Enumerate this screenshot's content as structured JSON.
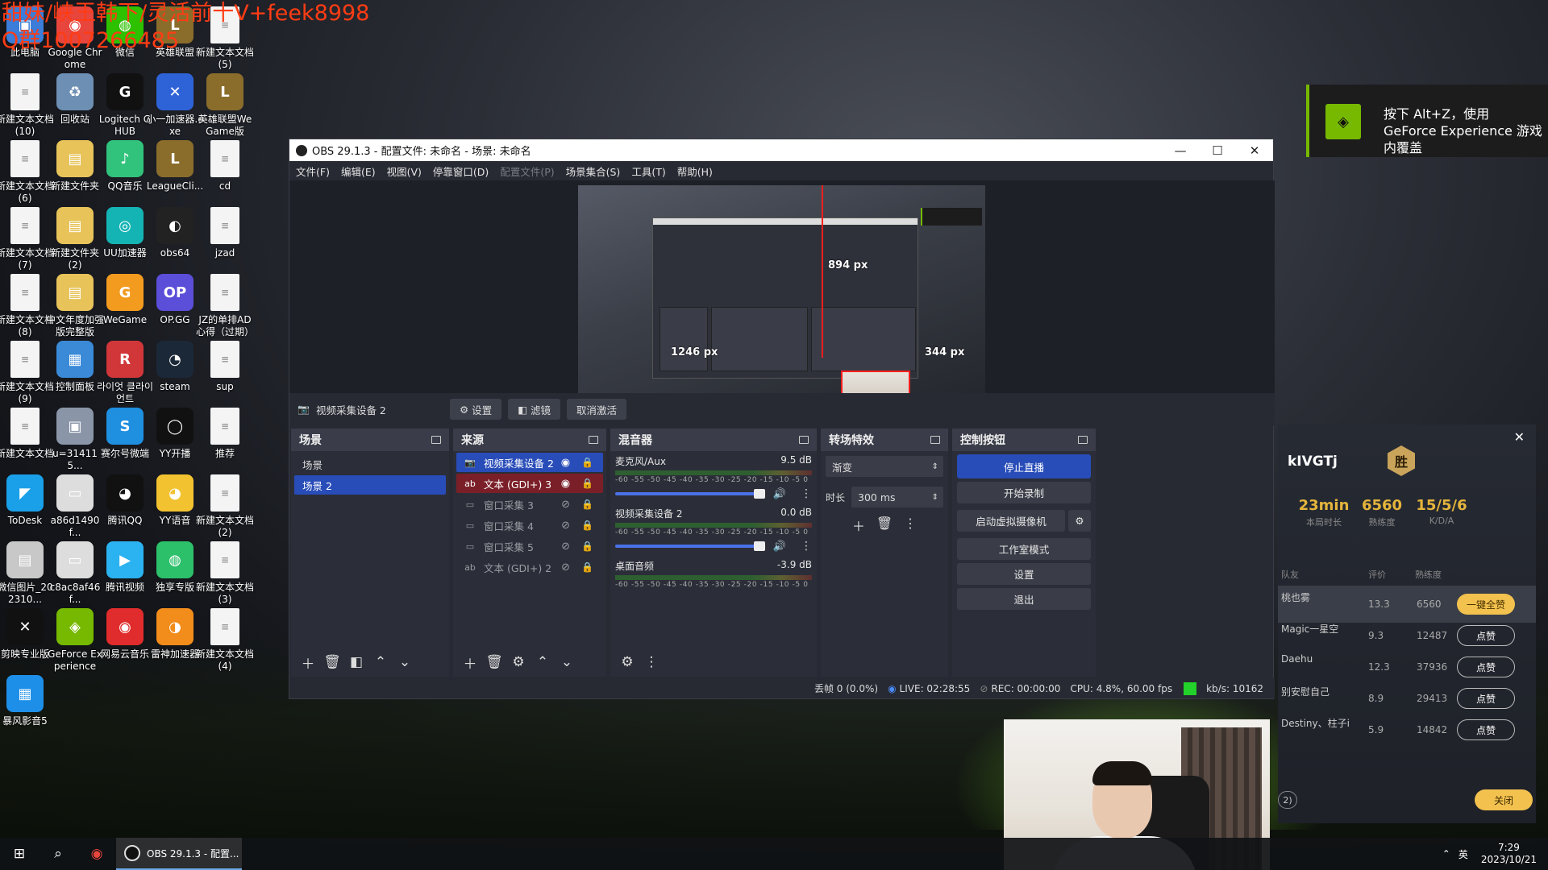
{
  "desktop": {
    "overlay_line1": "甜妹/峡王韩下/灵活前十V+feek8998",
    "overlay_line2": "Q群1007266485",
    "icons": [
      {
        "label": "此电脑",
        "glyph": "▣",
        "color": "#3b7dd8"
      },
      {
        "label": "Google Chrome",
        "glyph": "◉",
        "color": "#e8453c"
      },
      {
        "label": "微信",
        "glyph": "◍",
        "color": "#2dc100"
      },
      {
        "label": "英雄联盟",
        "glyph": "L",
        "color": "#8a6d2b"
      },
      {
        "label": "新建文本文档 (5)",
        "glyph": "",
        "color": ""
      },
      {
        "label": "新建文本文档 (10)",
        "glyph": "",
        "color": ""
      },
      {
        "label": "回收站",
        "glyph": "♻",
        "color": "#6d8fb3"
      },
      {
        "label": "Logitech G HUB",
        "glyph": "G",
        "color": "#111111"
      },
      {
        "label": "小一加速器.exe",
        "glyph": "✕",
        "color": "#2e63d8"
      },
      {
        "label": "英雄联盟WeGame版",
        "glyph": "L",
        "color": "#8a6d2b"
      },
      {
        "label": "新建文本文档 (6)",
        "glyph": "",
        "color": ""
      },
      {
        "label": "新建文件夹",
        "glyph": "▤",
        "color": "#e7c35a"
      },
      {
        "label": "QQ音乐",
        "glyph": "♪",
        "color": "#31c27c"
      },
      {
        "label": "LeagueCli...",
        "glyph": "L",
        "color": "#8a6d2b"
      },
      {
        "label": "cd",
        "glyph": "",
        "color": ""
      },
      {
        "label": "新建文本文档 (7)",
        "glyph": "",
        "color": ""
      },
      {
        "label": "新建文件夹 (2)",
        "glyph": "▤",
        "color": "#e7c35a"
      },
      {
        "label": "UU加速器",
        "glyph": "◎",
        "color": "#15b4b4"
      },
      {
        "label": "obs64",
        "glyph": "◐",
        "color": "#222222"
      },
      {
        "label": "jzad",
        "glyph": "",
        "color": ""
      },
      {
        "label": "新建文本文档 (8)",
        "glyph": "",
        "color": ""
      },
      {
        "label": "中文年度加强版完整版",
        "glyph": "▤",
        "color": "#e7c35a"
      },
      {
        "label": "WeGame",
        "glyph": "G",
        "color": "#f29b1f"
      },
      {
        "label": "OP.GG",
        "glyph": "OP",
        "color": "#5b4ed8"
      },
      {
        "label": "JZ的单排AD心得（过期）",
        "glyph": "",
        "color": ""
      },
      {
        "label": "新建文本文档 (9)",
        "glyph": "",
        "color": ""
      },
      {
        "label": "控制面板",
        "glyph": "▦",
        "color": "#3a8ad8"
      },
      {
        "label": "라이엇 클라이언트",
        "glyph": "R",
        "color": "#d13639"
      },
      {
        "label": "steam",
        "glyph": "◔",
        "color": "#1b2838"
      },
      {
        "label": "sup",
        "glyph": "",
        "color": ""
      },
      {
        "label": "新建文本文档",
        "glyph": "",
        "color": ""
      },
      {
        "label": "u=314115...",
        "glyph": "▣",
        "color": "#8a96a8"
      },
      {
        "label": "赛尔号微端",
        "glyph": "S",
        "color": "#1f8fe0"
      },
      {
        "label": "YY开播",
        "glyph": "◯",
        "color": "#111111"
      },
      {
        "label": "推荐",
        "glyph": "",
        "color": ""
      },
      {
        "label": "ToDesk",
        "glyph": "◤",
        "color": "#1aa0e8"
      },
      {
        "label": "a86d1490f...",
        "glyph": "▭",
        "color": "#dddddd"
      },
      {
        "label": "腾讯QQ",
        "glyph": "◕",
        "color": "#111111"
      },
      {
        "label": "YY语音",
        "glyph": "◕",
        "color": "#f2c230"
      },
      {
        "label": "新建文本文档 (2)",
        "glyph": "",
        "color": ""
      },
      {
        "label": "微信图片_202310...",
        "glyph": "▤",
        "color": "#c8c8c8"
      },
      {
        "label": "c8ac8af46f...",
        "glyph": "▭",
        "color": "#dddddd"
      },
      {
        "label": "腾讯视频",
        "glyph": "▶",
        "color": "#2bb2f0"
      },
      {
        "label": "独享专版",
        "glyph": "◍",
        "color": "#2cc06a"
      },
      {
        "label": "新建文本文档 (3)",
        "glyph": "",
        "color": ""
      },
      {
        "label": "剪映专业版",
        "glyph": "✕",
        "color": "#111111"
      },
      {
        "label": "GeForce Experience",
        "glyph": "◈",
        "color": "#76b900"
      },
      {
        "label": "网易云音乐",
        "glyph": "◉",
        "color": "#e02c2c"
      },
      {
        "label": "雷神加速器",
        "glyph": "◑",
        "color": "#f28c1a"
      },
      {
        "label": "新建文本文档 (4)",
        "glyph": "",
        "color": ""
      },
      {
        "label": "暴风影音5",
        "glyph": "▦",
        "color": "#1e8fe8"
      }
    ]
  },
  "geforce_overlay": {
    "text": "按下 Alt+Z，使用 GeForce Experience 游戏内覆盖"
  },
  "obs": {
    "title": "OBS 29.1.3 - 配置文件: 未命名 - 场景: 未命名",
    "window_buttons": {
      "minimize": "—",
      "maximize": "☐",
      "close": "✕"
    },
    "menu": [
      "文件(F)",
      "编辑(E)",
      "视图(V)",
      "停靠窗口(D)",
      "配置文件(P)",
      "场景集合(S)",
      "工具(T)",
      "帮助(H)"
    ],
    "preview": {
      "label_height": "894 px",
      "label_width": "1246 px",
      "label_right": "344 px"
    },
    "source_toolbar": {
      "selected_source": "视频采集设备 2",
      "settings": "设置",
      "filters": "滤镜",
      "deactivate": "取消激活"
    },
    "scenes": {
      "title": "场景",
      "items": [
        "场景",
        "场景 2"
      ],
      "selected_index": 1
    },
    "sources": {
      "title": "来源",
      "items": [
        {
          "icon": "📷",
          "name": "视频采集设备 2",
          "visible": true,
          "state": "selected"
        },
        {
          "icon": "ab",
          "name": "文本 (GDI+) 3",
          "visible": true,
          "state": "highlight"
        },
        {
          "icon": "▭",
          "name": "窗口采集 3",
          "visible": false,
          "state": "hidden"
        },
        {
          "icon": "▭",
          "name": "窗口采集 4",
          "visible": false,
          "state": "hidden"
        },
        {
          "icon": "▭",
          "name": "窗口采集 5",
          "visible": false,
          "state": "hidden"
        },
        {
          "icon": "ab",
          "name": "文本 (GDI+) 2",
          "visible": false,
          "state": "hidden"
        }
      ]
    },
    "mixer": {
      "title": "混音器",
      "ticks": "-60 -55 -50 -45 -40 -35 -30 -25 -20 -15 -10 -5 0",
      "channels": [
        {
          "name": "麦克风/Aux",
          "db": "9.5 dB"
        },
        {
          "name": "视频采集设备 2",
          "db": "0.0 dB"
        },
        {
          "name": "桌面音频",
          "db": "-3.9 dB"
        }
      ]
    },
    "transitions": {
      "title": "转场特效",
      "selected": "渐变",
      "duration_label": "时长",
      "duration_value": "300 ms"
    },
    "controls": {
      "title": "控制按钮",
      "stop_stream": "停止直播",
      "start_record": "开始录制",
      "virtual_cam": "启动虚拟摄像机",
      "studio_mode": "工作室模式",
      "settings": "设置",
      "exit": "退出"
    },
    "status": {
      "dropped": "丢帧 0 (0.0%)",
      "live": "LIVE: 02:28:55",
      "rec": "REC: 00:00:00",
      "cpu": "CPU: 4.8%, 60.00 fps",
      "kbps": "kb/s: 10162"
    }
  },
  "game_panel": {
    "player": "kIVGTj",
    "result_badge": "胜",
    "stats": [
      {
        "value": "23min",
        "label": "本局时长"
      },
      {
        "value": "6560",
        "label": "熟练度"
      },
      {
        "value": "15/5/6",
        "label": "K/D/A"
      }
    ],
    "headers": {
      "team": "队友",
      "score": "评价",
      "proficiency": "熟练度"
    },
    "rows": [
      {
        "name": "桃也雾",
        "score": "13.3",
        "proficiency": "6560",
        "action": "一键全赞"
      },
      {
        "name": "Magic一星空",
        "score": "9.3",
        "proficiency": "12487",
        "action": "点赞"
      },
      {
        "name": "Daehu",
        "score": "12.3",
        "proficiency": "37936",
        "action": "点赞"
      },
      {
        "name": "别安慰自己",
        "score": "8.9",
        "proficiency": "29413",
        "action": "点赞"
      },
      {
        "name": "Destiny、柱子i",
        "score": "5.9",
        "proficiency": "14842",
        "action": "点赞"
      }
    ],
    "page": "2)",
    "close_label": "关闭"
  },
  "taskbar": {
    "obs_task": "OBS 29.1.3 - 配置...",
    "ime": "英",
    "time": "7:29",
    "date": "2023/10/21"
  }
}
